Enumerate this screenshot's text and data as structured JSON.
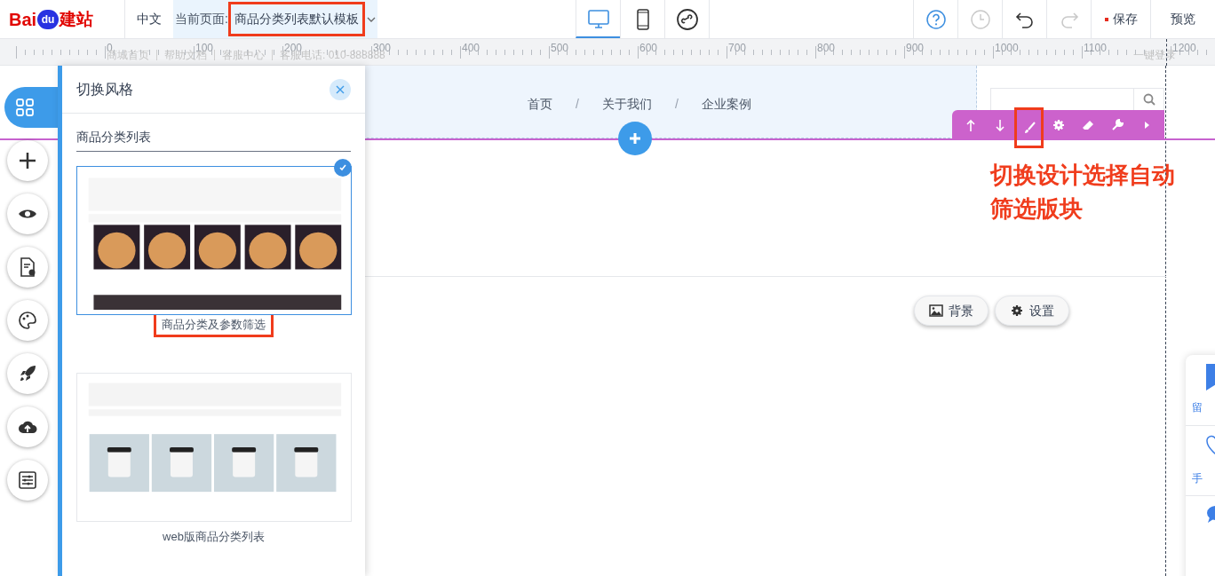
{
  "logo": {
    "text": "Bai",
    "badge": "du",
    "suffix": "建站"
  },
  "top_bar": {
    "language": "中文",
    "current_page_label": "当前页面: ",
    "current_page": "商品分类列表默认模板",
    "current_page_annotated": true,
    "device_tabs": [
      {
        "kind": "desktop",
        "selected": true
      },
      {
        "kind": "mobile",
        "selected": false
      },
      {
        "kind": "miniprogram",
        "selected": false
      }
    ],
    "actions": [
      {
        "kind": "help",
        "disabled": false
      },
      {
        "kind": "history",
        "disabled": true
      },
      {
        "kind": "undo",
        "disabled": false
      },
      {
        "kind": "redo",
        "disabled": true
      }
    ],
    "save": "保存",
    "preview": "预览"
  },
  "ruler": {
    "ticks": [
      "0",
      "100",
      "200",
      "300",
      "400",
      "500",
      "600",
      "700",
      "800",
      "900",
      "1000",
      "1100",
      "1200"
    ]
  },
  "site_top_links": [
    "商城首页",
    "帮助文档",
    "客服中心",
    "客服电话: 010-888888"
  ],
  "site_login": "一键登录",
  "left_toolbar": [
    {
      "kind": "modules",
      "selected": true
    },
    {
      "kind": "add",
      "selected": false
    },
    {
      "kind": "view",
      "selected": false
    },
    {
      "kind": "page-settings",
      "selected": false
    },
    {
      "kind": "theme",
      "selected": false
    },
    {
      "kind": "publish",
      "selected": false
    },
    {
      "kind": "upload",
      "selected": false
    },
    {
      "kind": "settings",
      "selected": false
    }
  ],
  "panel": {
    "title": "切换风格",
    "category": "商品分类列表",
    "templates": [
      {
        "name": "商品分类及参数筛选",
        "selected": true,
        "annotated": true,
        "kind": "photos"
      },
      {
        "name": "web版商品分类列表",
        "selected": false,
        "annotated": false,
        "kind": "cups"
      }
    ]
  },
  "canvas": {
    "nav": [
      "首页",
      "关于我们",
      "企业案例"
    ],
    "nav_separators": [
      "/",
      "/"
    ],
    "block_toolbar": [
      {
        "kind": "up",
        "annotated": false
      },
      {
        "kind": "down",
        "annotated": false
      },
      {
        "kind": "brush",
        "annotated": true
      },
      {
        "kind": "gear",
        "annotated": false
      },
      {
        "kind": "eraser",
        "annotated": false
      },
      {
        "kind": "wrench",
        "annotated": false
      },
      {
        "kind": "more",
        "annotated": false
      }
    ],
    "section_buttons": [
      {
        "kind": "background",
        "label": "背景"
      },
      {
        "kind": "settings",
        "label": "设置"
      }
    ]
  },
  "annotation": "切换设计选择自动筛选版块",
  "float_panel": [
    {
      "kind": "message",
      "label": "留"
    },
    {
      "kind": "phone",
      "label": "手"
    },
    {
      "kind": "chat"
    }
  ]
}
